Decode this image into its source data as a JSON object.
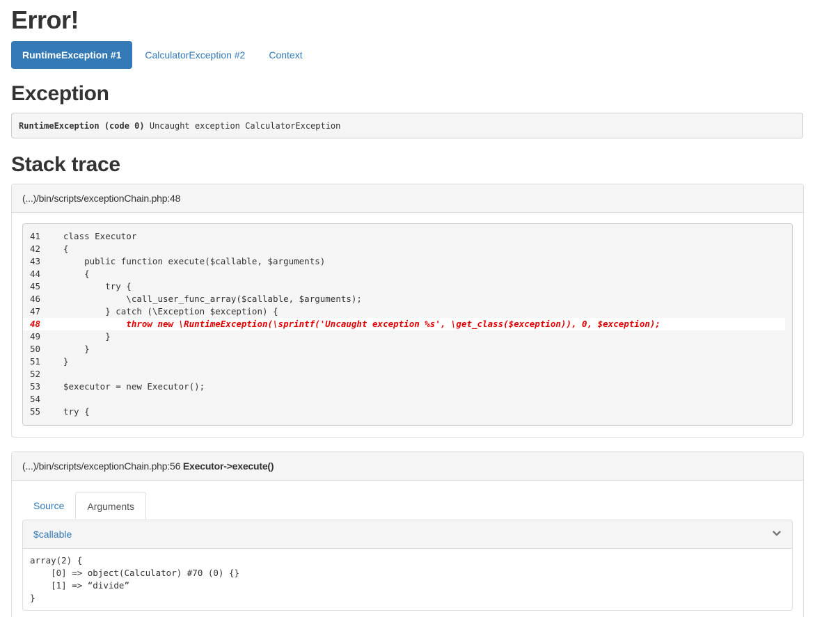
{
  "page": {
    "title": "Error!"
  },
  "tabs": [
    {
      "label": "RuntimeException #1",
      "active": true
    },
    {
      "label": "CalculatorException #2",
      "active": false
    },
    {
      "label": "Context",
      "active": false
    }
  ],
  "exception": {
    "heading": "Exception",
    "class_code": "RuntimeException (code 0)",
    "message": " Uncaught exception CalculatorException"
  },
  "stack_trace": {
    "heading": "Stack trace",
    "frames": [
      {
        "location": "(...)/bin/scripts/exceptionChain.php:48",
        "call": "",
        "highlight_line": "48",
        "lines": [
          {
            "num": "41",
            "code": "class Executor"
          },
          {
            "num": "42",
            "code": "{"
          },
          {
            "num": "43",
            "code": "    public function execute($callable, $arguments)"
          },
          {
            "num": "44",
            "code": "    {"
          },
          {
            "num": "45",
            "code": "        try {"
          },
          {
            "num": "46",
            "code": "            \\call_user_func_array($callable, $arguments);"
          },
          {
            "num": "47",
            "code": "        } catch (\\Exception $exception) {"
          },
          {
            "num": "48",
            "code": "            throw new \\RuntimeException(\\sprintf('Uncaught exception %s', \\get_class($exception)), 0, $exception);"
          },
          {
            "num": "49",
            "code": "        }"
          },
          {
            "num": "50",
            "code": "    }"
          },
          {
            "num": "51",
            "code": "}"
          },
          {
            "num": "52",
            "code": ""
          },
          {
            "num": "53",
            "code": "$executor = new Executor();"
          },
          {
            "num": "54",
            "code": ""
          },
          {
            "num": "55",
            "code": "try {"
          }
        ]
      },
      {
        "location": "(...)/bin/scripts/exceptionChain.php:56",
        "call": "Executor->execute()",
        "sub_tabs": [
          {
            "label": "Source",
            "active": false
          },
          {
            "label": "Arguments",
            "active": true
          }
        ],
        "argument": {
          "name": "$callable",
          "icon": "chevron-down-icon",
          "value_lines": [
            "array(2) {",
            "    [0] => object(Calculator) #70 (0) {}",
            "    [1] => “divide”",
            "}"
          ]
        }
      }
    ]
  },
  "colors": {
    "accent": "#337ab7",
    "highlight": "#e00000",
    "panel_bg": "#f5f5f5",
    "border": "#dddddd"
  }
}
